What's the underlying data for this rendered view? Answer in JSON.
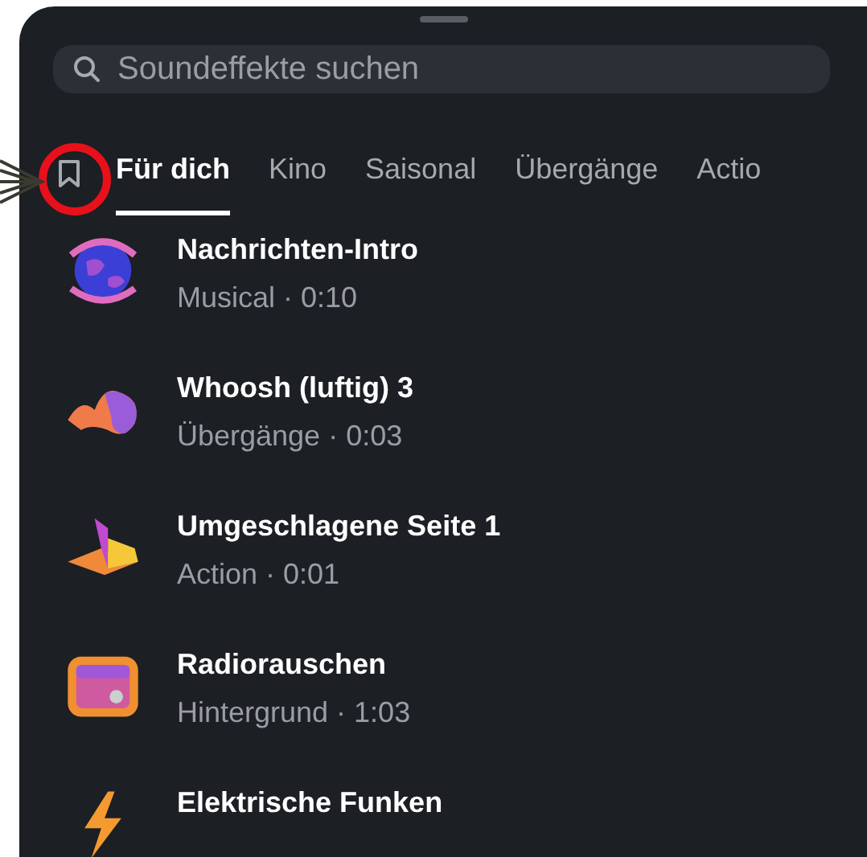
{
  "search": {
    "placeholder": "Soundeffekte suchen"
  },
  "tabs": [
    {
      "label": "Für dich",
      "selected": true
    },
    {
      "label": "Kino",
      "selected": false
    },
    {
      "label": "Saisonal",
      "selected": false
    },
    {
      "label": "Übergänge",
      "selected": false
    },
    {
      "label": "Actio",
      "selected": false
    }
  ],
  "sounds": [
    {
      "kind": "globe",
      "title": "Nachrichten-Intro",
      "subtitle": "Musical · 0:10"
    },
    {
      "kind": "wave",
      "title": "Whoosh (luftig) 3",
      "subtitle": "Übergänge · 0:03"
    },
    {
      "kind": "book",
      "title": "Umgeschlagene Seite 1",
      "subtitle": "Action · 0:01"
    },
    {
      "kind": "radio",
      "title": "Radiorauschen",
      "subtitle": "Hintergrund · 1:03"
    },
    {
      "kind": "bolt",
      "title": "Elektrische Funken"
    }
  ]
}
